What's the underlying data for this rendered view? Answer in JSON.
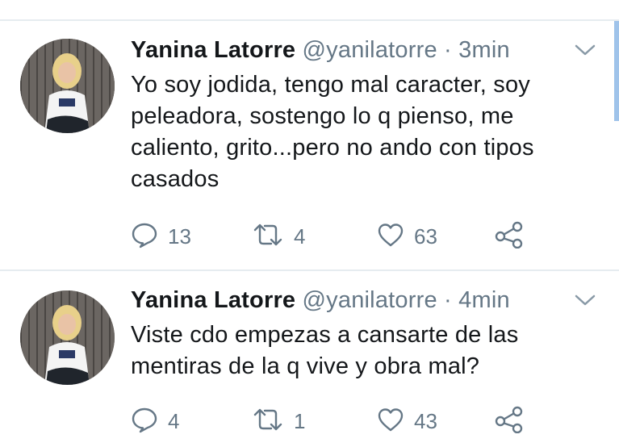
{
  "tweets": [
    {
      "name": "Yanina Latorre",
      "handle": "@yanilatorre",
      "separator": "·",
      "time": "3min",
      "text": "Yo soy jodida, tengo mal caracter, soy peleadora, sostengo lo q pienso, me caliento, grito...pero no ando con tipos casados",
      "replies": "13",
      "retweets": "4",
      "likes": "63"
    },
    {
      "name": "Yanina Latorre",
      "handle": "@yanilatorre",
      "separator": "·",
      "time": "4min",
      "text": "Viste cdo empezas a cansarte de las mentiras de la q vive y obra mal?",
      "replies": "4",
      "retweets": "1",
      "likes": "43"
    }
  ],
  "icons": {
    "reply": "reply-icon",
    "retweet": "retweet-icon",
    "like": "heart-icon",
    "share": "share-icon",
    "menu": "chevron-down-icon"
  },
  "colors": {
    "text": "#14171a",
    "secondary": "#657786",
    "divider": "#e6ecf0"
  }
}
